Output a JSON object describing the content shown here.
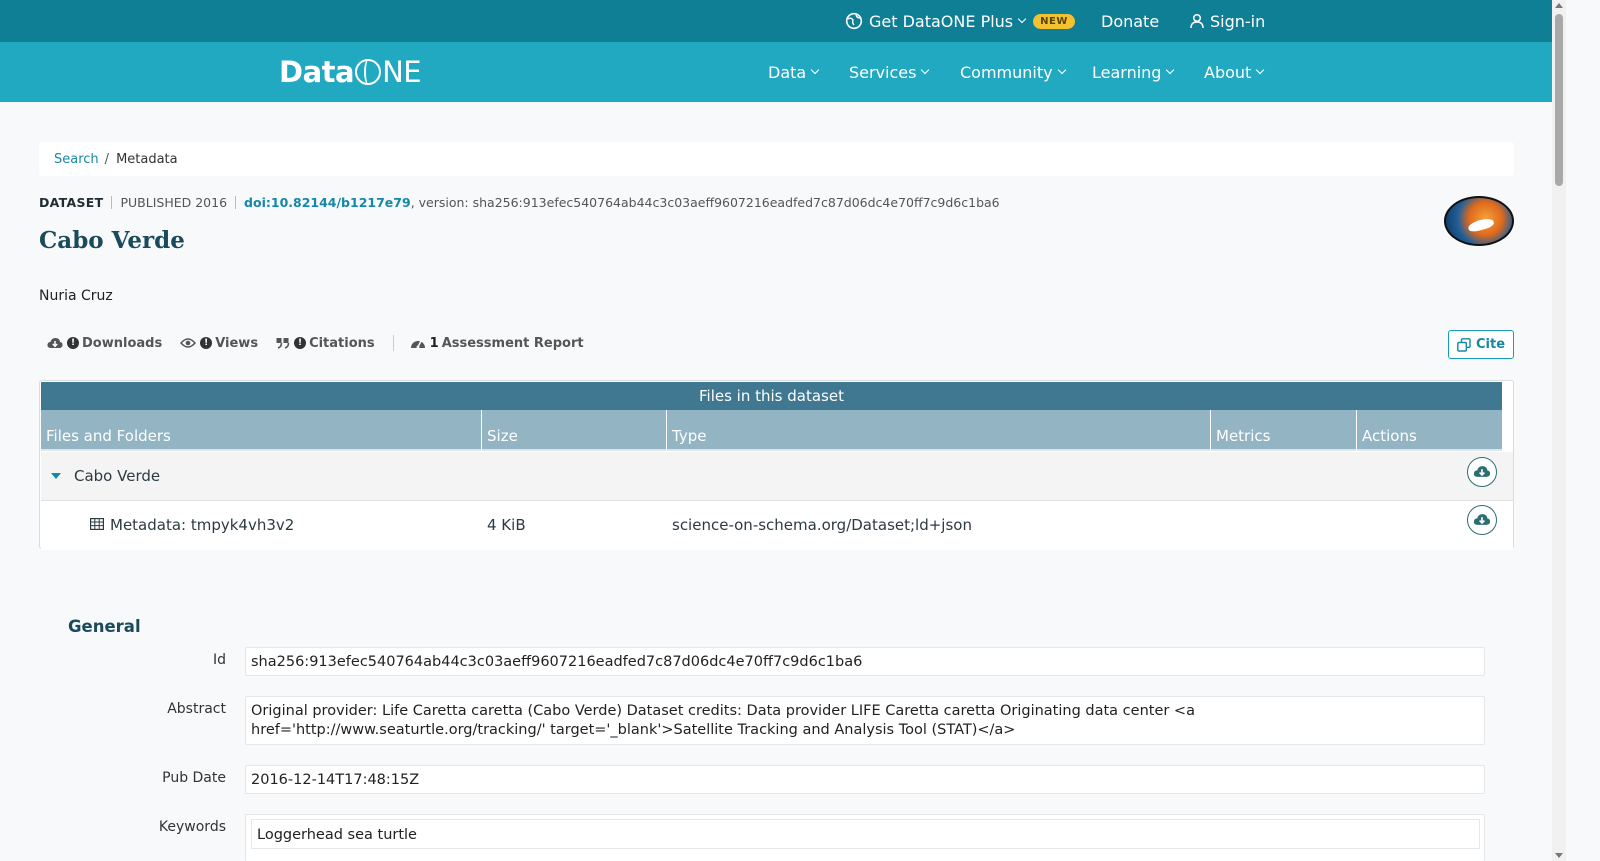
{
  "topbar": {
    "plus_label": "Get DataONE Plus",
    "new_badge": "NEW",
    "donate_label": "Donate",
    "signin_label": "Sign-in"
  },
  "navbar": {
    "logo_text_left": "Data",
    "logo_text_right": "NE",
    "items": [
      {
        "label": "Data"
      },
      {
        "label": "Services"
      },
      {
        "label": "Community"
      },
      {
        "label": "Learning"
      },
      {
        "label": "About"
      }
    ]
  },
  "breadcrumb": {
    "search": "Search",
    "separator": "/",
    "current": "Metadata"
  },
  "citation": {
    "type": "DATASET",
    "published": "PUBLISHED 2016",
    "doi": "doi:10.82144/b1217e79",
    "version": ", version: sha256:913efec540764ab44c3c03aeff9607216eadfed7c87d06dc4e70ff7c9d6c1ba6"
  },
  "dataset": {
    "title": "Cabo Verde",
    "author": "Nuria Cruz"
  },
  "metrics": {
    "downloads": "Downloads",
    "views": "Views",
    "citations": "Citations",
    "assessment_count": "1",
    "assessment_label": "Assessment Report",
    "cite_button": "Cite"
  },
  "files": {
    "caption": "Files in this dataset",
    "columns": [
      "Files and Folders",
      "Size",
      "Type",
      "Metrics",
      "Actions"
    ],
    "folder": {
      "name": "Cabo Verde"
    },
    "rows": [
      {
        "name": "Metadata: tmpyk4vh3v2",
        "size": "4 KiB",
        "type": "science-on-schema.org/Dataset;ld+json"
      }
    ]
  },
  "general": {
    "title": "General",
    "fields": [
      {
        "label": "Id",
        "value": "sha256:913efec540764ab44c3c03aeff9607216eadfed7c87d06dc4e70ff7c9d6c1ba6"
      },
      {
        "label": "Abstract",
        "value_line1": "Original provider: Life Caretta caretta (Cabo Verde) Dataset credits: Data provider LIFE Caretta caretta Originating data center <a",
        "value_line2": "href='http://www.seaturtle.org/tracking/' target='_blank'>Satellite Tracking and Analysis Tool (STAT)</a>"
      },
      {
        "label": "Pub Date",
        "value": "2016-12-14T17:48:15Z"
      },
      {
        "label": "Keywords",
        "value": "Loggerhead sea turtle"
      }
    ]
  },
  "colors": {
    "topbar": "#0f7f95",
    "navbar": "#21a9c1",
    "table_caption": "#3f7890",
    "table_header": "#92b4c3",
    "link": "#1587a8"
  }
}
